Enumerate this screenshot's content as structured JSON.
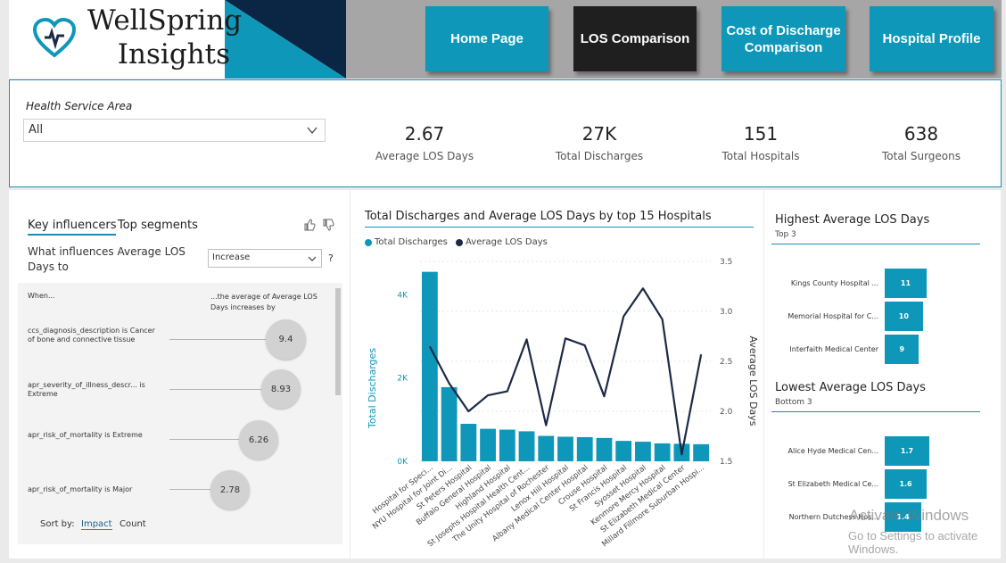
{
  "brand": {
    "line1": "WellSpring",
    "line2": "Insights"
  },
  "nav": {
    "home": "Home Page",
    "los": "LOS Comparison",
    "cost": "Cost of Discharge Comparison",
    "profile": "Hospital Profile"
  },
  "filter": {
    "label": "Health Service Area",
    "value": "All"
  },
  "kpis": [
    {
      "value": "2.67",
      "label": "Average LOS Days"
    },
    {
      "value": "27K",
      "label": "Total Discharges"
    },
    {
      "value": "151",
      "label": "Total Hospitals"
    },
    {
      "value": "638",
      "label": "Total Surgeons"
    }
  ],
  "key_influencers": {
    "tab_active": "Key influencers",
    "tab_other": "Top segments",
    "question": "What influences Average LOS Days to",
    "direction": "Increase",
    "help": "?",
    "col_left": "When...",
    "col_right": "...the average of Average LOS Days increases by",
    "rows": [
      {
        "text": "ccs_diagnosis_description is Cancer of bone and connective tissue",
        "value": "9.4"
      },
      {
        "text": "apr_severity_of_illness_descr... is Extreme",
        "value": "8.93"
      },
      {
        "text": "apr_risk_of_mortality is Extreme",
        "value": "6.26"
      },
      {
        "text": "apr_risk_of_mortality is Major",
        "value": "2.78"
      }
    ],
    "sort_label": "Sort by:",
    "sort_impact": "Impact",
    "sort_count": "Count"
  },
  "chart_data": {
    "type": "bar",
    "title": "Total Discharges and Average LOS Days by top 15 Hospitals",
    "categories": [
      "Hospital for Speci...",
      "NYU Hospital for Joint Di...",
      "St Peters Hospital",
      "Buffalo General Hospital",
      "Highland Hospital",
      "St Josephs Hospital Health Cent...",
      "The Unity Hospital of Rochester",
      "Lenox Hill Hospital",
      "Albany Medical Center Hospital",
      "Crouse Hospital",
      "St Francis Hospital",
      "Syosset Hospital",
      "Kenmore Mercy Hospital",
      "St Elizabeth Medical Center",
      "Millard Fillmore Suburban Hospi..."
    ],
    "series": [
      {
        "name": "Total Discharges",
        "kind": "bar",
        "axis": "left",
        "color": "#0e97b9",
        "values": [
          4550,
          1780,
          900,
          780,
          760,
          720,
          610,
          590,
          580,
          560,
          490,
          470,
          430,
          420,
          410
        ]
      },
      {
        "name": "Average LOS Days",
        "kind": "line",
        "axis": "right",
        "color": "#1b2a47",
        "values": [
          2.65,
          2.28,
          2.0,
          2.16,
          2.2,
          2.72,
          1.86,
          2.73,
          2.66,
          2.15,
          2.95,
          3.23,
          2.92,
          1.57,
          2.57
        ]
      }
    ],
    "ylabel": "Total Discharges",
    "y2label": "Average LOS Days",
    "ylim": [
      0,
      4800
    ],
    "yticks": [
      "0K",
      "2K",
      "4K"
    ],
    "y2lim": [
      1.5,
      3.5
    ],
    "y2ticks": [
      "1.5",
      "2.0",
      "2.5",
      "3.0",
      "3.5"
    ],
    "legend_position": "top-left"
  },
  "highest": {
    "title": "Highest Average LOS Days",
    "subtitle": "Top 3",
    "items": [
      {
        "label": "Kings County Hospital ...",
        "value": 11
      },
      {
        "label": "Memorial Hospital for C...",
        "value": 10
      },
      {
        "label": "Interfaith Medical Center",
        "value": 9
      }
    ]
  },
  "lowest": {
    "title": "Lowest Average LOS Days",
    "subtitle": "Bottom 3",
    "items": [
      {
        "label": "Alice Hyde Medical Cen...",
        "value": 1.7
      },
      {
        "label": "St Elizabeth Medical Ce...",
        "value": 1.6
      },
      {
        "label": "Northern Dutchess Hos...",
        "value": 1.4
      }
    ]
  },
  "watermark": {
    "line1": "Activate Windows",
    "line2": "Go to Settings to activate Windows."
  },
  "colors": {
    "accent": "#0e97b9",
    "navy": "#0b2545",
    "line": "#1b2a47",
    "active_nav": "#1f1f1f"
  }
}
